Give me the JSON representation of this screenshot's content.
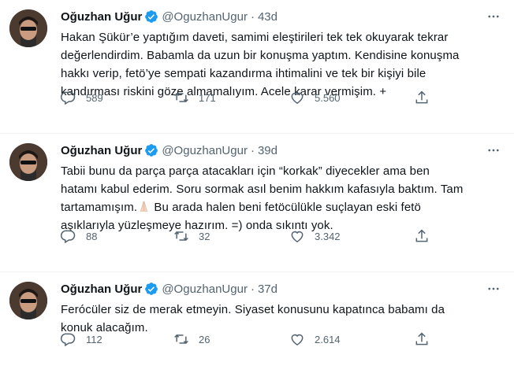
{
  "colors": {
    "verified": "#1d9bf0",
    "secondary": "#536471",
    "text": "#0f1419"
  },
  "icons": {
    "reply": "reply-icon",
    "retweet": "retweet-icon",
    "like": "heart-icon",
    "share": "share-icon",
    "more": "more-icon",
    "verified": "verified-badge-icon"
  },
  "tweets": [
    {
      "name": "Oğuzhan Uğur",
      "handle": "@OguzhanUgur",
      "dot": "·",
      "time": "43d",
      "lines": [
        "Hakan Şükür’e yaptığım daveti, samimi eleştirileri tek tek okuyarak tekrar",
        "değerlendirdim. Babamla da uzun bir konuşma yaptım. Kendisine konuşma",
        "hakkı verip, fetö’ye sempati kazandırma ihtimalini ve tek bir kişiyi bile",
        "kandırması riskini göze almamalıyım. Acele karar vermişim. +"
      ],
      "replies": "589",
      "retweets": "171",
      "likes": "5.560"
    },
    {
      "name": "Oğuzhan Uğur",
      "handle": "@OguzhanUgur",
      "dot": "·",
      "time": "39d",
      "lines": [
        "Tabii bunu da parça parça atacakları için “korkak” diyecekler ama ben",
        "hatamı kabul ederim. Soru sormak asıl benim hakkım kafasıyla baktım. Tam",
        "tartamamışım.",
        " Bu arada halen beni fetöcülükle suçlayan eski fetö",
        "aşıklarıyla yüzleşmeye hazırım. =) onda sıkıntı yok."
      ],
      "replies": "88",
      "retweets": "32",
      "likes": "3.342"
    },
    {
      "name": "Oğuzhan Uğur",
      "handle": "@OguzhanUgur",
      "dot": "·",
      "time": "37d",
      "lines": [
        "Ferócüler siz de merak etmeyin. Siyaset konusunu kapatınca babamı da",
        "konuk alacağım."
      ],
      "replies": "112",
      "retweets": "26",
      "likes": "2.614"
    }
  ]
}
